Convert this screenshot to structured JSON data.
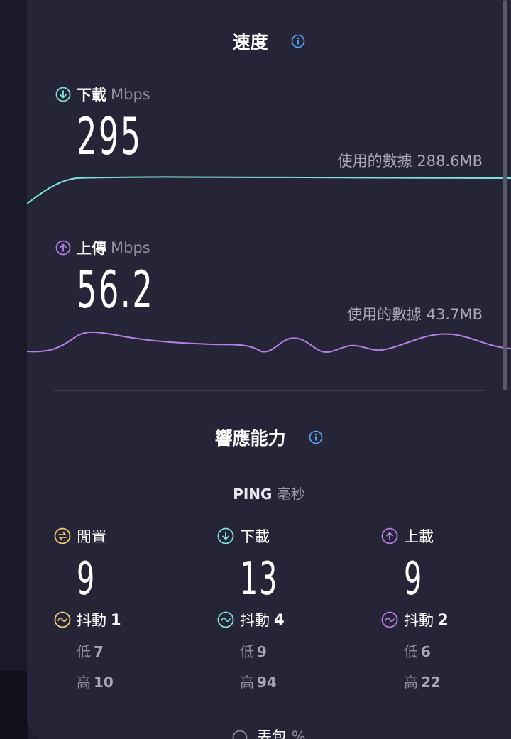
{
  "speed": {
    "title": "速度",
    "download": {
      "label": "下載",
      "unit": "Mbps",
      "value": "295",
      "data_used": "使用的數據 288.6MB",
      "color": "#7fe3dc"
    },
    "upload": {
      "label": "上傳",
      "unit": "Mbps",
      "value": "56.2",
      "data_used": "使用的數據 43.7MB",
      "color": "#b57fe8"
    }
  },
  "responsiveness": {
    "title": "響應能力",
    "ping_label": "PING",
    "ping_unit": "毫秒",
    "idle": {
      "label": "閒置",
      "value": "9",
      "jitter_label": "抖動",
      "jitter": "1",
      "low_label": "低",
      "low": "7",
      "high_label": "高",
      "high": "10",
      "color": "#f2cf7a"
    },
    "download": {
      "label": "下載",
      "value": "13",
      "jitter_label": "抖動",
      "jitter": "4",
      "low_label": "低",
      "low": "9",
      "high_label": "高",
      "high": "94",
      "color": "#7fe3dc"
    },
    "upload": {
      "label": "上載",
      "value": "9",
      "jitter_label": "抖動",
      "jitter": "2",
      "low_label": "低",
      "low": "6",
      "high_label": "高",
      "high": "22",
      "color": "#b57fe8"
    }
  },
  "packet_loss": {
    "label": "丟包",
    "unit": "%"
  },
  "colors": {
    "info": "#5aa7ff",
    "panel": "#262537"
  }
}
